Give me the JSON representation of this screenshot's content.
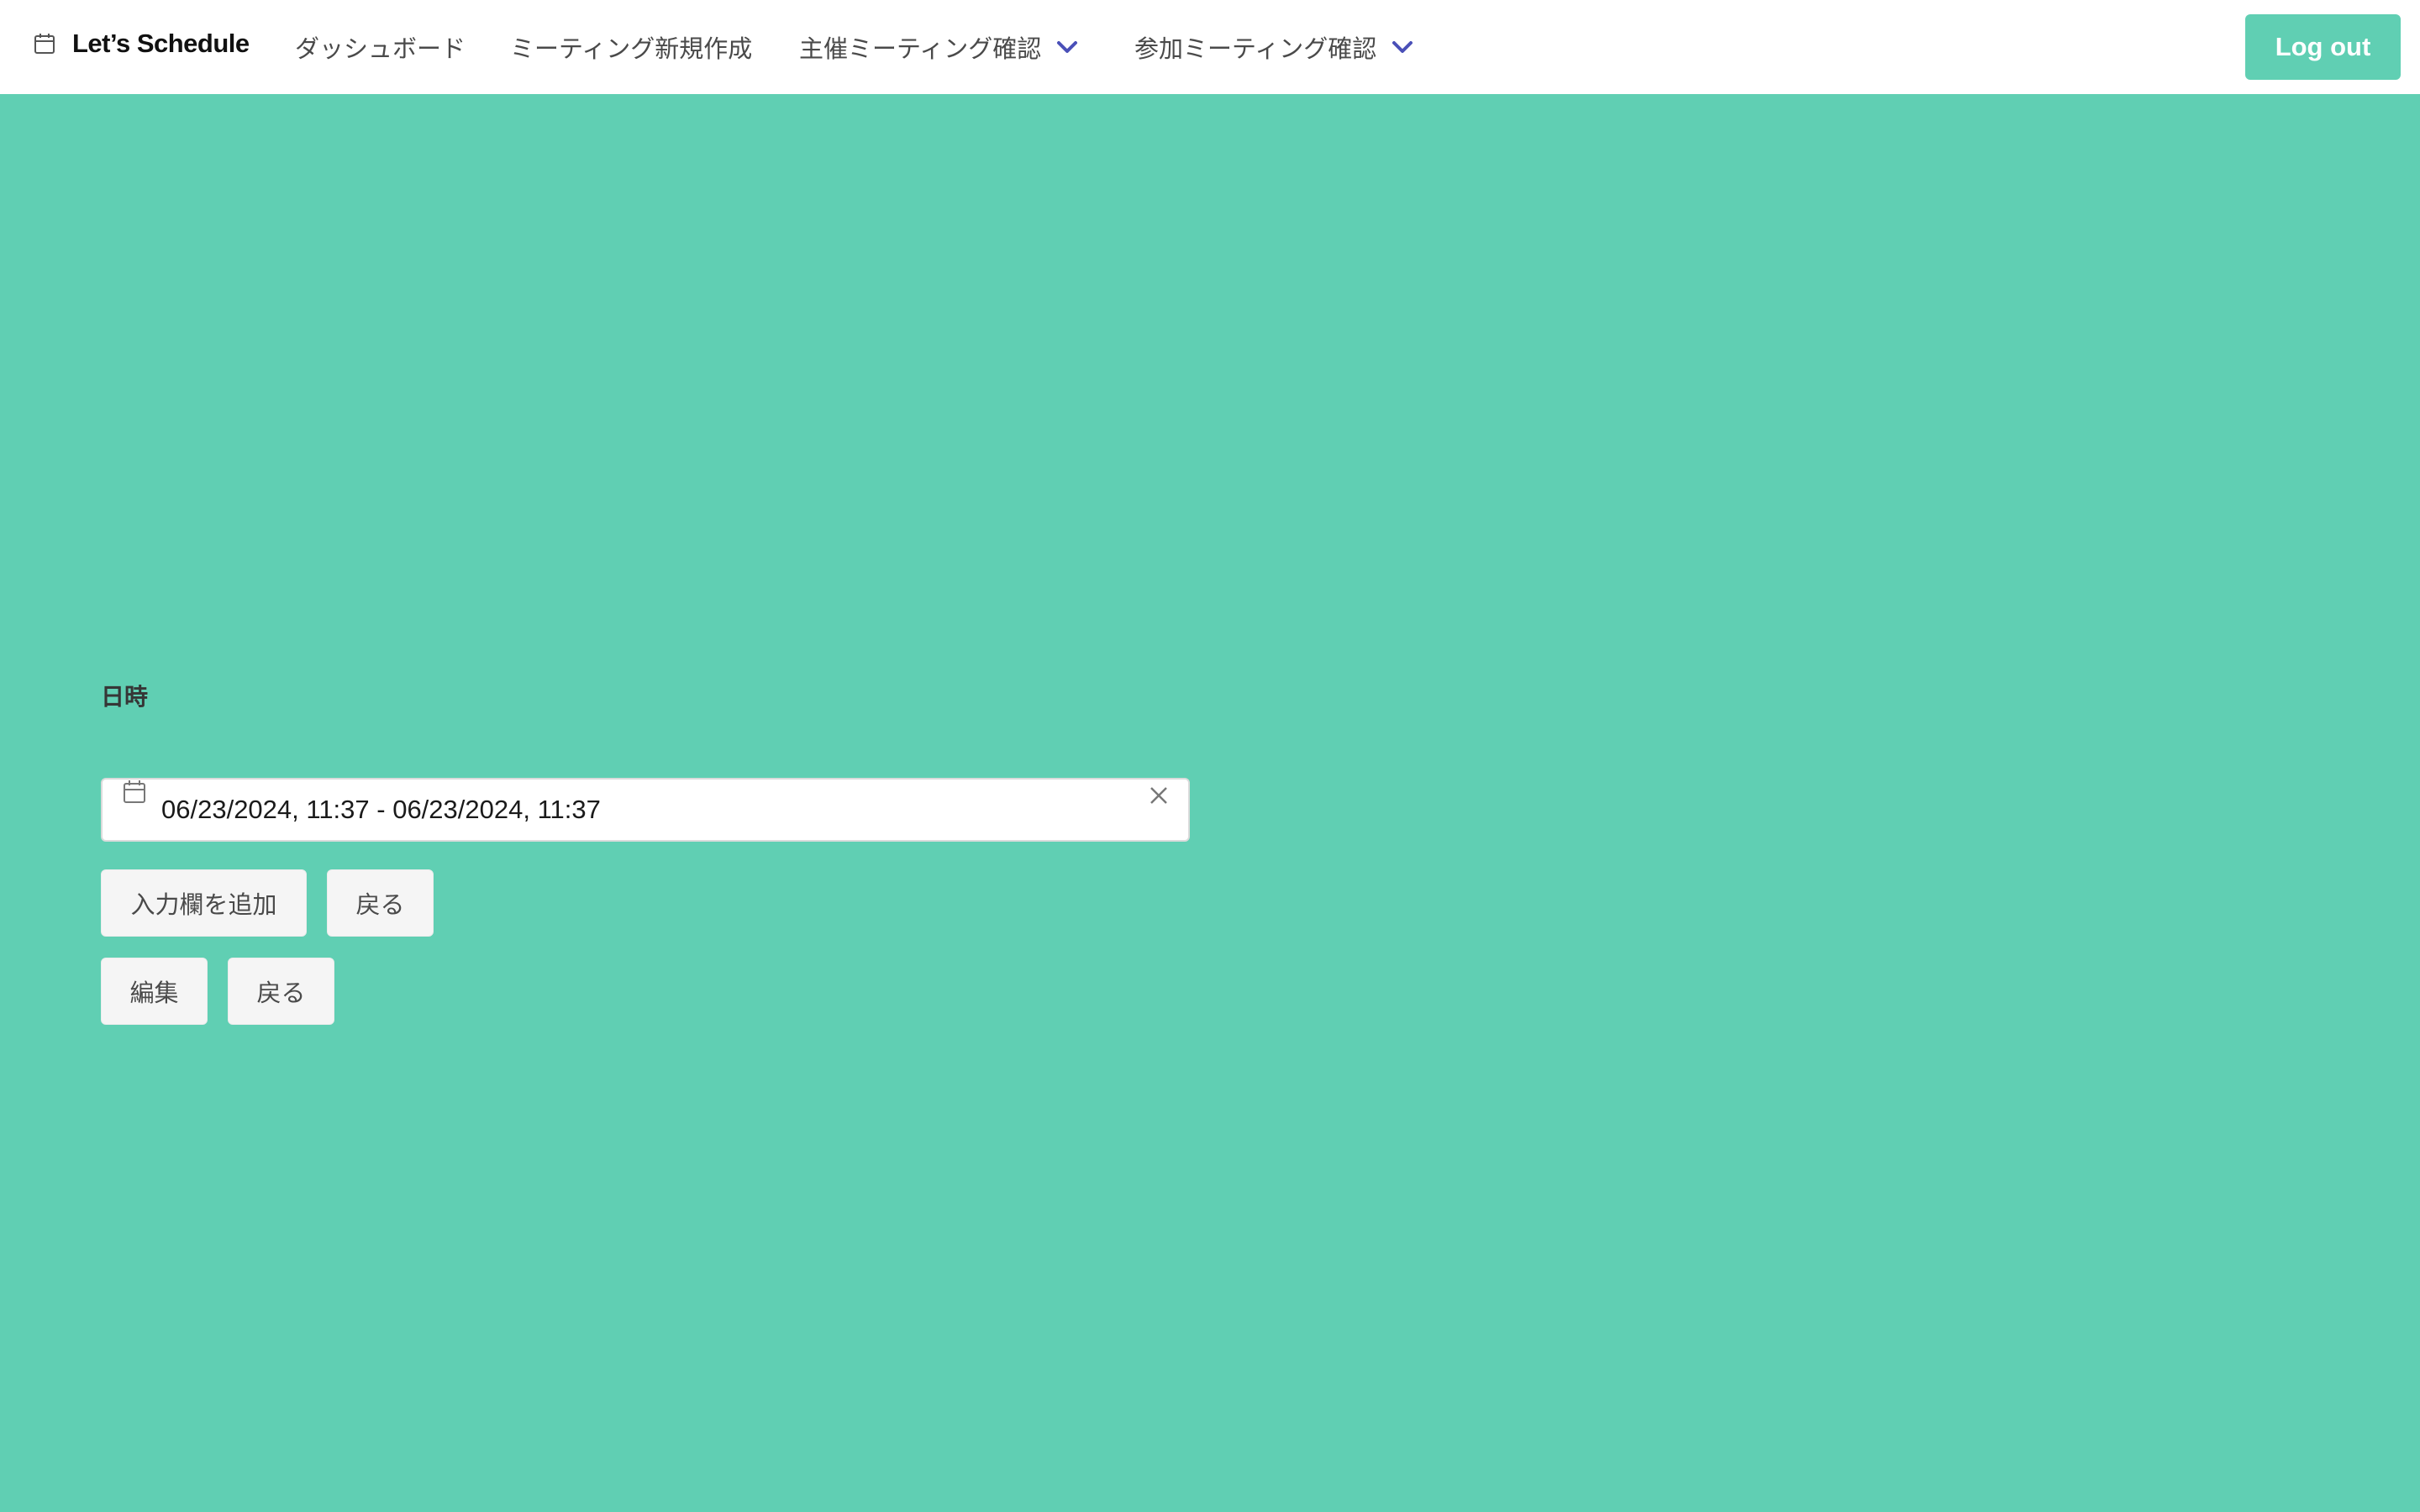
{
  "navbar": {
    "brand": {
      "icon": "calendar-icon",
      "title": "Let’s Schedule"
    },
    "items": [
      {
        "label": "ダッシュボード"
      },
      {
        "label": "ミーティング新規作成"
      },
      {
        "label": "主催ミーティング確認",
        "icon": "chevron-down-icon"
      },
      {
        "label": "参加ミーティング確認",
        "icon": "chevron-down-icon"
      }
    ],
    "logout_label": "Log out"
  },
  "form": {
    "datetime_label": "日時",
    "datetime_value": "06/23/2024, 11:37 - 06/23/2024, 11:37",
    "add_field_label": "入力欄を追加",
    "back_label_1": "戻る",
    "edit_label": "編集",
    "back_label_2": "戻る"
  },
  "colors": {
    "background": "#60cfb3",
    "accent": "#60cfb3",
    "chevron": "#4a50b8"
  }
}
